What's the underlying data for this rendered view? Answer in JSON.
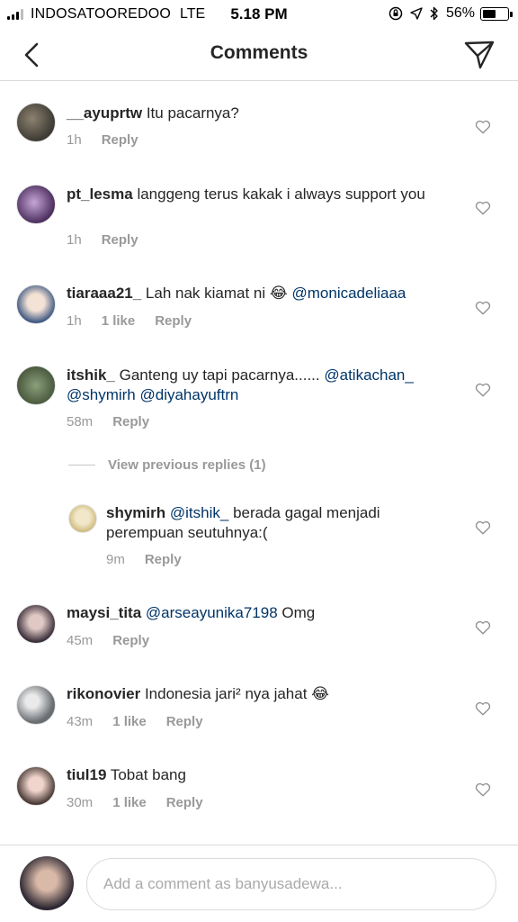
{
  "status_bar": {
    "carrier": "INDOSATOOREDOO",
    "network": "LTE",
    "time": "5.18 PM",
    "battery": "56%",
    "battery_level": 0.56
  },
  "header": {
    "title": "Comments",
    "back_icon": "chevron-left-icon",
    "send_icon": "paper-plane-icon"
  },
  "comments": [
    {
      "username": "__ayuprtw",
      "text": "Itu pacarnya?",
      "time": "1h",
      "likes": "",
      "reply": "Reply"
    },
    {
      "username": "pt_lesma",
      "text": "langgeng terus kakak i always support you",
      "time": "1h",
      "likes": "",
      "reply": "Reply"
    },
    {
      "username": "tiaraaa21_",
      "text": "Lah nak kiamat ni 😂",
      "mention": "@monicadeliaaa",
      "time": "1h",
      "likes": "1 like",
      "reply": "Reply"
    },
    {
      "username": "itshik_",
      "text": "Ganteng uy tapi pacarnya......",
      "mention": "@atikachan_ @shymirh @diyahayuftrn",
      "time": "58m",
      "likes": "",
      "reply": "Reply"
    },
    {
      "username": "maysi_tita",
      "mention": "@arseayunika7198",
      "text": "Omg",
      "time": "45m",
      "likes": "",
      "reply": "Reply"
    },
    {
      "username": "rikonovier",
      "text": "Indonesia jari² nya jahat 😂",
      "time": "43m",
      "likes": "1 like",
      "reply": "Reply"
    },
    {
      "username": "tiul19",
      "text": "Tobat bang",
      "time": "30m",
      "likes": "1 like",
      "reply": "Reply"
    }
  ],
  "view_previous": "View previous replies (1)",
  "reply_comment": {
    "username": "shymirh",
    "mention": "@itshik_",
    "text": "berada gagal menjadi perempuan seutuhnya:(",
    "time": "9m",
    "reply": "Reply"
  },
  "footer": {
    "placeholder": "Add a comment as banyusadewa..."
  },
  "colors": {
    "mention": "#003569",
    "meta": "#999999",
    "divider": "#dbdbdb"
  }
}
